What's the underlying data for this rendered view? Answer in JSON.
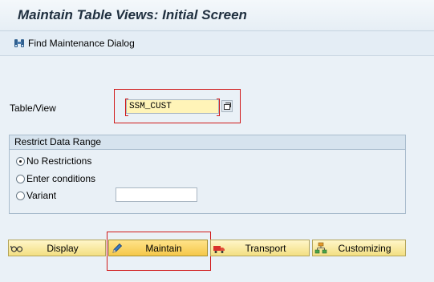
{
  "window": {
    "title": "Maintain Table Views: Initial Screen"
  },
  "toolbar": {
    "find_label": "Find Maintenance Dialog",
    "find_icon": "binoculars-icon"
  },
  "form": {
    "table_view_label": "Table/View",
    "table_view_value": "SSM_CUST",
    "value_help_icon": "value-help-icon"
  },
  "restrict": {
    "title": "Restrict Data Range",
    "options": [
      {
        "label": "No Restrictions",
        "checked": true
      },
      {
        "label": "Enter conditions",
        "checked": false
      },
      {
        "label": "Variant",
        "checked": false
      }
    ],
    "variant_value": ""
  },
  "buttons": {
    "display": "Display",
    "maintain": "Maintain",
    "transport": "Transport",
    "customizing": "Customizing"
  },
  "colors": {
    "highlight_red": "#d01919",
    "button_yellow": "#f3df82",
    "input_yellow": "#fff4b8"
  }
}
